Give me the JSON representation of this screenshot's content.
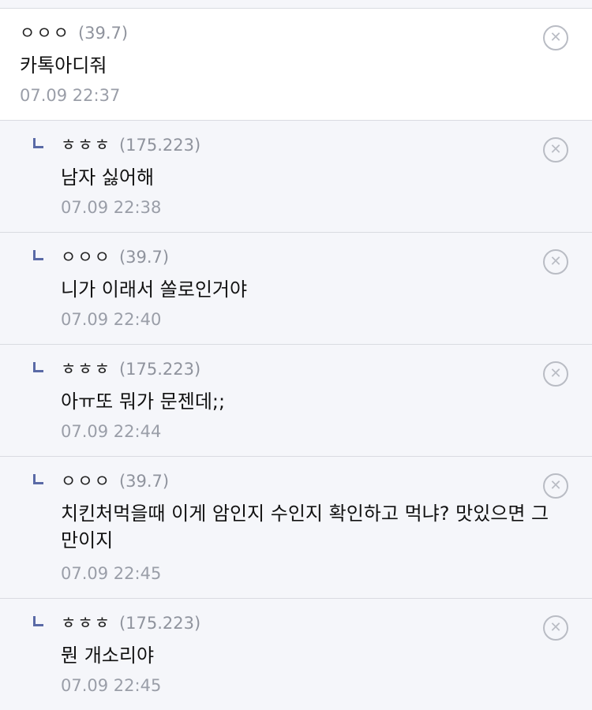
{
  "comments": [
    {
      "nick": "ㅇㅇㅇ",
      "ip": "(39.7)",
      "text": "카톡아디줘",
      "date": "07.09 22:37",
      "delete_icon": "close-circle-icon"
    },
    {
      "nick": "ㅎㅎㅎ",
      "ip": "(175.223)",
      "text": "남자 싫어해",
      "date": "07.09 22:38",
      "delete_icon": "close-circle-icon"
    },
    {
      "nick": "ㅇㅇㅇ",
      "ip": "(39.7)",
      "text": "니가 이래서 쏠로인거야",
      "date": "07.09 22:40",
      "delete_icon": "close-circle-icon"
    },
    {
      "nick": "ㅎㅎㅎ",
      "ip": "(175.223)",
      "text": "아ㅠ또 뭐가 문젠데;;",
      "date": "07.09 22:44",
      "delete_icon": "close-circle-icon"
    },
    {
      "nick": "ㅇㅇㅇ",
      "ip": "(39.7)",
      "text": "치킨처먹을때 이게 암인지 수인지 확인하고 먹냐? 맛있으면 그만이지",
      "date": "07.09 22:45",
      "delete_icon": "close-circle-icon"
    },
    {
      "nick": "ㅎㅎㅎ",
      "ip": "(175.223)",
      "text": "뭔 개소리야",
      "date": "07.09 22:45",
      "delete_icon": "close-circle-icon"
    }
  ],
  "colors": {
    "reply_marker": "#5a6aa6",
    "ip_text": "#8f939d",
    "date_text": "#9a9ea8",
    "reply_bg": "#f5f6fa",
    "root_bg": "#ffffff"
  }
}
